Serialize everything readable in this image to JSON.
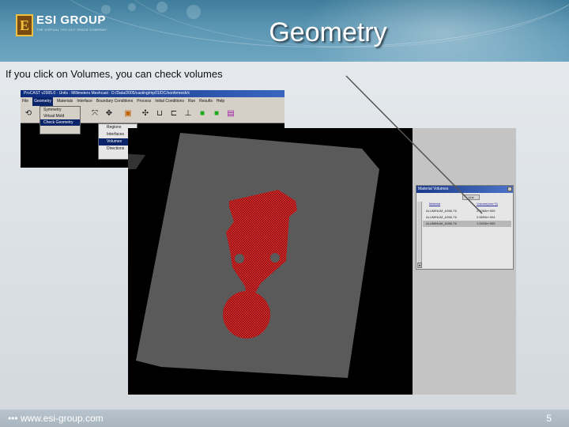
{
  "header": {
    "logo_initial": "E",
    "logo_name": "ESI GROUP",
    "logo_tagline": "THE VIRTUAL TRY-OUT SPACE COMPANY",
    "title": "Geometry"
  },
  "body": {
    "instruction": "If you click on Volumes, you can check volumes"
  },
  "app_window": {
    "title": "ProCAST v2005.0 - Units : Millimeters Meshcast : D:/Data/2005/casting/mp01/DC/nonfemesh/c",
    "menus": [
      "File",
      "Geometry",
      "Materials",
      "Interface",
      "Boundary Conditions",
      "Process",
      "Initial Conditions",
      "Run",
      "Results",
      "Help"
    ],
    "geometry_menu_items": [
      "Symmetry",
      "Virtual Mold",
      "Check Geometry"
    ],
    "check_geometry_submenu": [
      "Regions",
      "Interfaces",
      "Volumes",
      "Directions"
    ]
  },
  "material_volumes": {
    "title": "Material Volumes",
    "button": "Unit",
    "columns": [
      "Material",
      "Volume(mm^3)"
    ],
    "rows": [
      {
        "material": "ALUMINUM_A356-T6",
        "volume": "2.1065e+005"
      },
      {
        "material": "ALUMINUM_A356-T6",
        "volume": "2.6893e+004"
      },
      {
        "material": "ALUMINUM_A356-T6",
        "volume": "1.0003e+005"
      }
    ]
  },
  "footer": {
    "url": "www.esi-group.com",
    "page_number": "5"
  },
  "colors": {
    "header_blue": "#4a88a8",
    "mesh_red": "#d62828",
    "mold_gray": "#5a5a5a"
  }
}
